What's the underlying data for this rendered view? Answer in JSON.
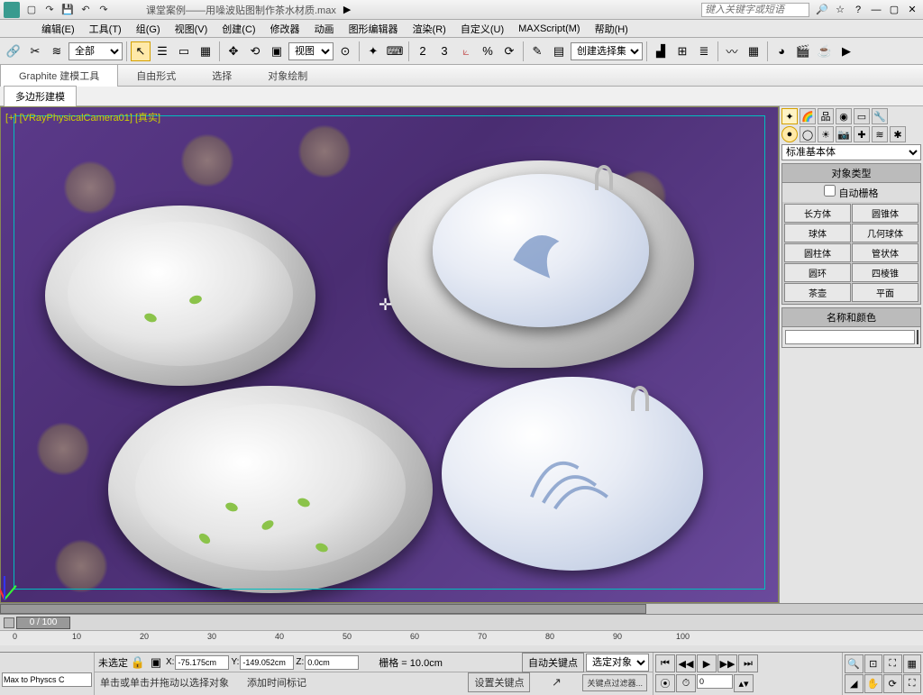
{
  "titlebar": {
    "filename": "课堂案例——用噪波贴图制作茶水材质.max",
    "search_placeholder": "键入关键字或短语"
  },
  "menu": [
    "编辑(E)",
    "工具(T)",
    "组(G)",
    "视图(V)",
    "创建(C)",
    "修改器",
    "动画",
    "图形编辑器",
    "渲染(R)",
    "自定义(U)",
    "MAXScript(M)",
    "帮助(H)"
  ],
  "toolbar": {
    "selection_filter": "全部",
    "ref_coord": "视图",
    "named_sel": "创建选择集"
  },
  "ribbon": {
    "tabs": [
      "Graphite 建模工具",
      "自由形式",
      "选择",
      "对象绘制"
    ],
    "subtab": "多边形建模"
  },
  "viewport": {
    "label": "[+] [VRayPhysicalCamera01] [真实]"
  },
  "panel": {
    "primitive_dropdown": "标准基本体",
    "rollouts": {
      "object_type": "对象类型",
      "autogrid": "自动栅格",
      "name_color": "名称和颜色"
    },
    "primitives": [
      [
        "长方体",
        "圆锥体"
      ],
      [
        "球体",
        "几何球体"
      ],
      [
        "圆柱体",
        "管状体"
      ],
      [
        "圆环",
        "四棱锥"
      ],
      [
        "茶壶",
        "平面"
      ]
    ]
  },
  "timeline": {
    "slider": "0 / 100",
    "start": 0,
    "end": 100
  },
  "status": {
    "misc": "Max to Physcs C",
    "selection": "未选定",
    "x": "-75.175cm",
    "y": "-149.052cm",
    "z": "0.0cm",
    "grid": "栅格 = 10.0cm",
    "autokey": "自动关键点",
    "selected": "选定对象",
    "prompt1": "单击或单击并拖动以选择对象",
    "prompt2": "添加时间标记",
    "setkey": "设置关键点",
    "keyfilter": "关键点过滤器..."
  }
}
